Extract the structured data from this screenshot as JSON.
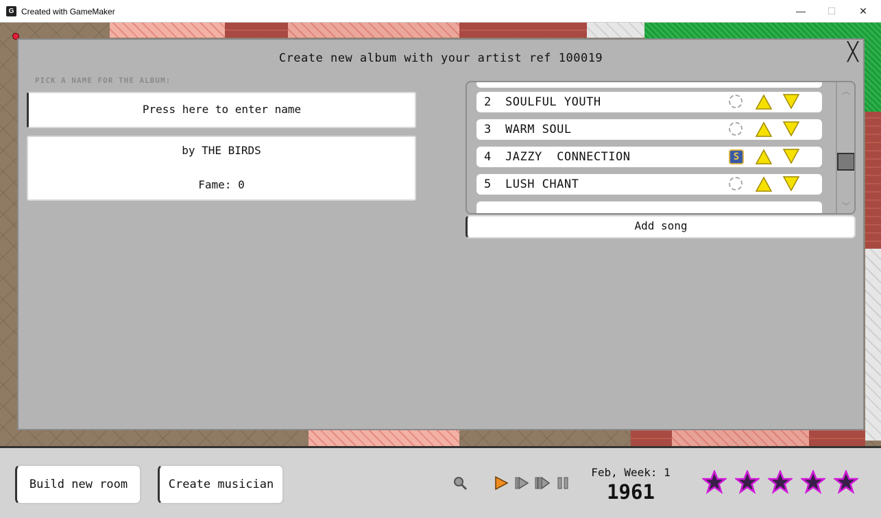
{
  "window": {
    "title": "Created with GameMaker",
    "minimize_glyph": "—",
    "maximize_glyph": "☐",
    "close_glyph": "✕"
  },
  "dialog": {
    "title": "Create new album with your artist ref 100019",
    "close_glyph": "╳",
    "pick_label": "PICK A NAME FOR THE ALBUM:",
    "name_placeholder": "Press here to enter name",
    "by_line": "by THE BIRDS",
    "fame_line": "Fame: 0",
    "songs": [
      {
        "num": "2",
        "name": "SOULFUL YOUTH",
        "single": false
      },
      {
        "num": "3",
        "name": "WARM SOUL",
        "single": false
      },
      {
        "num": "4",
        "name": "JAZZY  CONNECTION",
        "single": true,
        "single_label": "S"
      },
      {
        "num": "5",
        "name": "LUSH CHANT",
        "single": false
      }
    ],
    "add_song_label": "Add song"
  },
  "bottombar": {
    "build_room_label": "Build new room",
    "create_musician_label": "Create musician",
    "date": "Feb, Week: 1",
    "year": "1961",
    "stars_total": 5
  },
  "colors": {
    "dialog_bg": "#b4b4b4",
    "up_arrow": "#f5e000",
    "down_arrow": "#f5e000",
    "star_fill": "#3a1e4a",
    "star_outline": "#d01ad8",
    "play_orange": "#f08c1e"
  }
}
